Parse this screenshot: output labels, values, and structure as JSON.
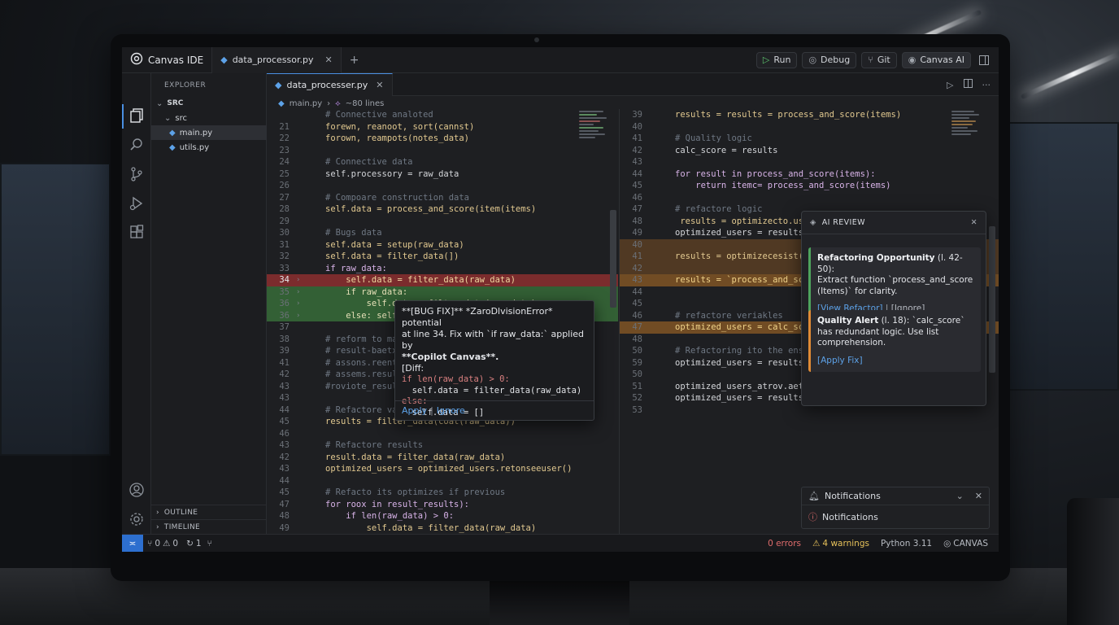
{
  "app": {
    "name": "Canvas IDE",
    "tab": "data_processor.py",
    "actions": [
      "Run",
      "Debug",
      "Git",
      "Canvas AI"
    ]
  },
  "explorer": {
    "title": "EXPLORER",
    "section": "SRC",
    "folder": "src",
    "files": [
      "main.py",
      "utils.py"
    ],
    "selected": "main.py",
    "outline": "OUTLINE",
    "timeline": "TIMELINE"
  },
  "editor": {
    "tab": "data_processer.py",
    "breadcrumb_file": "main.py",
    "breadcrumb_lines": "~80 lines"
  },
  "left_code": [
    {
      "n": "",
      "t": "# Connective analoted",
      "k": "com"
    },
    {
      "n": "21",
      "t": "forewn, reanoot, sort(cannst)",
      "k": "mix"
    },
    {
      "n": "22",
      "t": "forown, reampots(notes_data)",
      "k": "mix"
    },
    {
      "n": "23",
      "t": "",
      "k": ""
    },
    {
      "n": "24",
      "t": "# Connective data",
      "k": "com"
    },
    {
      "n": "25",
      "t": "self.processory = raw_data",
      "k": "plain"
    },
    {
      "n": "26",
      "t": "",
      "k": ""
    },
    {
      "n": "27",
      "t": "# Compoare construction data",
      "k": "com"
    },
    {
      "n": "28",
      "t": "self.data = process_and_score(item(items)",
      "k": "mix"
    },
    {
      "n": "29",
      "t": "",
      "k": ""
    },
    {
      "n": "30",
      "t": "# Bugs data",
      "k": "com"
    },
    {
      "n": "31",
      "t": "self.data = setup(raw_data)",
      "k": "mix"
    },
    {
      "n": "32",
      "t": "self.data = filter_data(])",
      "k": "mix"
    },
    {
      "n": "33",
      "t": "if raw_data:",
      "k": "kw"
    },
    {
      "n": "34",
      "t": "    self.data = filter_data(raw_data)",
      "k": "red"
    },
    {
      "n": "35",
      "t": "    if raw_data:",
      "k": "green"
    },
    {
      "n": "36",
      "t": "        self.data = filter_data(raw_data)",
      "k": "green"
    },
    {
      "n": "36",
      "t": "    else: self.data = []",
      "k": "green"
    },
    {
      "n": "37",
      "t": "",
      "k": ""
    },
    {
      "n": "38",
      "t": "# reform to match",
      "k": "com"
    },
    {
      "n": "39",
      "t": "# result-baetxs",
      "k": "com"
    },
    {
      "n": "41",
      "t": "# assons.reentl",
      "k": "com"
    },
    {
      "n": "42",
      "t": "# assems.results",
      "k": "com"
    },
    {
      "n": "43",
      "t": "#roviote_results",
      "k": "com"
    },
    {
      "n": "43",
      "t": "",
      "k": ""
    },
    {
      "n": "44",
      "t": "# Refactore values",
      "k": "com"
    },
    {
      "n": "45",
      "t": "results = filter_data(coat(raw_data))",
      "k": "mix"
    },
    {
      "n": "46",
      "t": "",
      "k": ""
    },
    {
      "n": "43",
      "t": "# Refactore results",
      "k": "com"
    },
    {
      "n": "42",
      "t": "result.data = filter_data(raw_data)",
      "k": "mix"
    },
    {
      "n": "43",
      "t": "optimized_users = optimized_users.retonseeuser()",
      "k": "mix"
    },
    {
      "n": "44",
      "t": "",
      "k": ""
    },
    {
      "n": "45",
      "t": "# Refacto its optimizes if previous",
      "k": "com"
    },
    {
      "n": "47",
      "t": "for roox in result_results):",
      "k": "kw"
    },
    {
      "n": "48",
      "t": "    if len(raw_data) > 0:",
      "k": "kw"
    },
    {
      "n": "49",
      "t": "        self.data = filter_data(raw_data)",
      "k": "mix"
    }
  ],
  "right_code": [
    {
      "n": "39",
      "t": "results = results = process_and_score(items)",
      "k": "mix"
    },
    {
      "n": "40",
      "t": "",
      "k": ""
    },
    {
      "n": "41",
      "t": "# Quality logic",
      "k": "com"
    },
    {
      "n": "42",
      "t": "calc_score = results",
      "k": "plain"
    },
    {
      "n": "43",
      "t": "",
      "k": ""
    },
    {
      "n": "44",
      "t": "for result in process_and_score(items):",
      "k": "kw"
    },
    {
      "n": "45",
      "t": "    return itemc= process_and_score(items)",
      "k": "kw"
    },
    {
      "n": "46",
      "t": "",
      "k": ""
    },
    {
      "n": "47",
      "t": "# refactore logic",
      "k": "com"
    },
    {
      "n": "48",
      "t": " results = optimizecto.users",
      "k": "mix"
    },
    {
      "n": "49",
      "t": "optimized_users = results.",
      "k": "plain"
    },
    {
      "n": "40",
      "t": "",
      "k": "orange"
    },
    {
      "n": "41",
      "t": "results = optimizecesist(",
      "k": "orange"
    },
    {
      "n": "42",
      "t": "",
      "k": "orange"
    },
    {
      "n": "43",
      "t": "results = `process_and_sco",
      "k": "orange2"
    },
    {
      "n": "44",
      "t": "",
      "k": ""
    },
    {
      "n": "45",
      "t": "",
      "k": ""
    },
    {
      "n": "46",
      "t": "# refactore veriakles",
      "k": "com"
    },
    {
      "n": "47",
      "t": "optimized_users = calc_scor",
      "k": "orange2"
    },
    {
      "n": "48",
      "t": "",
      "k": ""
    },
    {
      "n": "50",
      "t": "# Refactoring ito the ensus",
      "k": "com"
    },
    {
      "n": "59",
      "t": "optimized_users = results.a",
      "k": "plain"
    },
    {
      "n": "50",
      "t": "",
      "k": ""
    },
    {
      "n": "51",
      "t": "optimized_users_atrov.aete",
      "k": "plain"
    },
    {
      "n": "52",
      "t": "optimized_users = results.l",
      "k": "plain"
    },
    {
      "n": "53",
      "t": "",
      "k": ""
    }
  ],
  "popup": {
    "line1": "**[BUG FIX]** *ZaroDlvisionError* potential",
    "line2": "at line 34. Fix with `if raw_data:` applied by",
    "line3": "**Copilot Canvas**.",
    "line4": "[Diff:",
    "code": [
      "if len(raw_data) > 0:",
      "  self.data = filter_data(raw_data)",
      "else:",
      "  self.data = []"
    ],
    "apply": "Apply",
    "sep": "|",
    "ignore": "Ignore"
  },
  "ai_review": {
    "title": "AI REVIEW",
    "card1_title": "Refactoring Opportunity",
    "card1_range": " (l. 42-50):",
    "card1_body": "Extract function `process_and_score (Items)` for clarity.",
    "card1_link": "[View Refactor]",
    "card1_sep": " | ",
    "card1_ignore": "[Ignore]",
    "card2_title": "Quality Alert",
    "card2_range": " (l. 18): `calc_score` has redundant logic. Use list comprehension.",
    "card2_link": "[Apply Fix]"
  },
  "notifications": {
    "title": "Notifications",
    "item": "Notifications"
  },
  "status": {
    "git": "0",
    "warnings_left": "0",
    "sync": "1",
    "errors": "0 errors",
    "warnings": "4 warnings",
    "lang": "Python 3.11",
    "brand": "CANVAS"
  },
  "colors": {
    "accent": "#4a8fe2",
    "removed": "#c83737",
    "added": "#469646",
    "warning": "#e08b35"
  }
}
